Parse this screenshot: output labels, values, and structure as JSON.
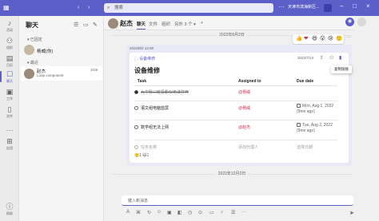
{
  "titlebar": {
    "search_placeholder": "搜索",
    "tenant": "天津市滨海新区..."
  },
  "rail": {
    "items": [
      {
        "label": "活动",
        "icon": "bell-icon"
      },
      {
        "label": "组织",
        "icon": "org-icon"
      },
      {
        "label": "日历",
        "icon": "calendar-icon"
      },
      {
        "label": "聊天",
        "icon": "chat-icon"
      },
      {
        "label": "工作",
        "icon": "briefcase-icon"
      },
      {
        "label": "文件",
        "icon": "file-icon"
      },
      {
        "label": "应用",
        "icon": "apps-icon"
      },
      {
        "label": "帮助",
        "icon": "help-icon"
      }
    ]
  },
  "chatlist": {
    "title": "聊天",
    "pinned_label": "已固定",
    "recent_label": "最近",
    "pinned": [
      {
        "name": "杨威(你)"
      }
    ],
    "recent": [
      {
        "name": "赵杰",
        "subtitle": "Loop component",
        "time": "4/19"
      }
    ]
  },
  "header": {
    "name": "赵杰",
    "tabs": [
      "聊天",
      "文件",
      "组织",
      "另外 3 个"
    ],
    "active_tab": "聊天"
  },
  "chat": {
    "date1": "2022年8月2日",
    "date2": "2022年12月2日",
    "reactions": [
      "👍",
      "❤",
      "😆",
      "😮",
      "😢",
      "🙂"
    ],
    "card": {
      "meta": "2022/8/2 12:00",
      "app": "设备维修",
      "date": "2022/7/14",
      "title": "设备维修",
      "tooltip": "复制链接",
      "columns": [
        "Task",
        "Assigned to",
        "Due date"
      ],
      "rows": [
        {
          "task": "九中除三班投影仪无法打开",
          "assignee": "@杨威",
          "due": "",
          "done": true
        },
        {
          "task": "语文组电脑蓝屏",
          "assignee": "@杨威",
          "due": "Mon, Aug 1, 2022 (9mo ago)",
          "done": false
        },
        {
          "task": "数学组无法上网",
          "assignee": "@赵杰",
          "due": "Tue, Aug 2, 2022 (9mo ago)",
          "done": false
        }
      ],
      "add_task": "任务名称",
      "add_assignee": "添加代理人",
      "add_date": "选择日期",
      "footer": "🙂1 😺1"
    },
    "composer_placeholder": "键入新消息"
  }
}
